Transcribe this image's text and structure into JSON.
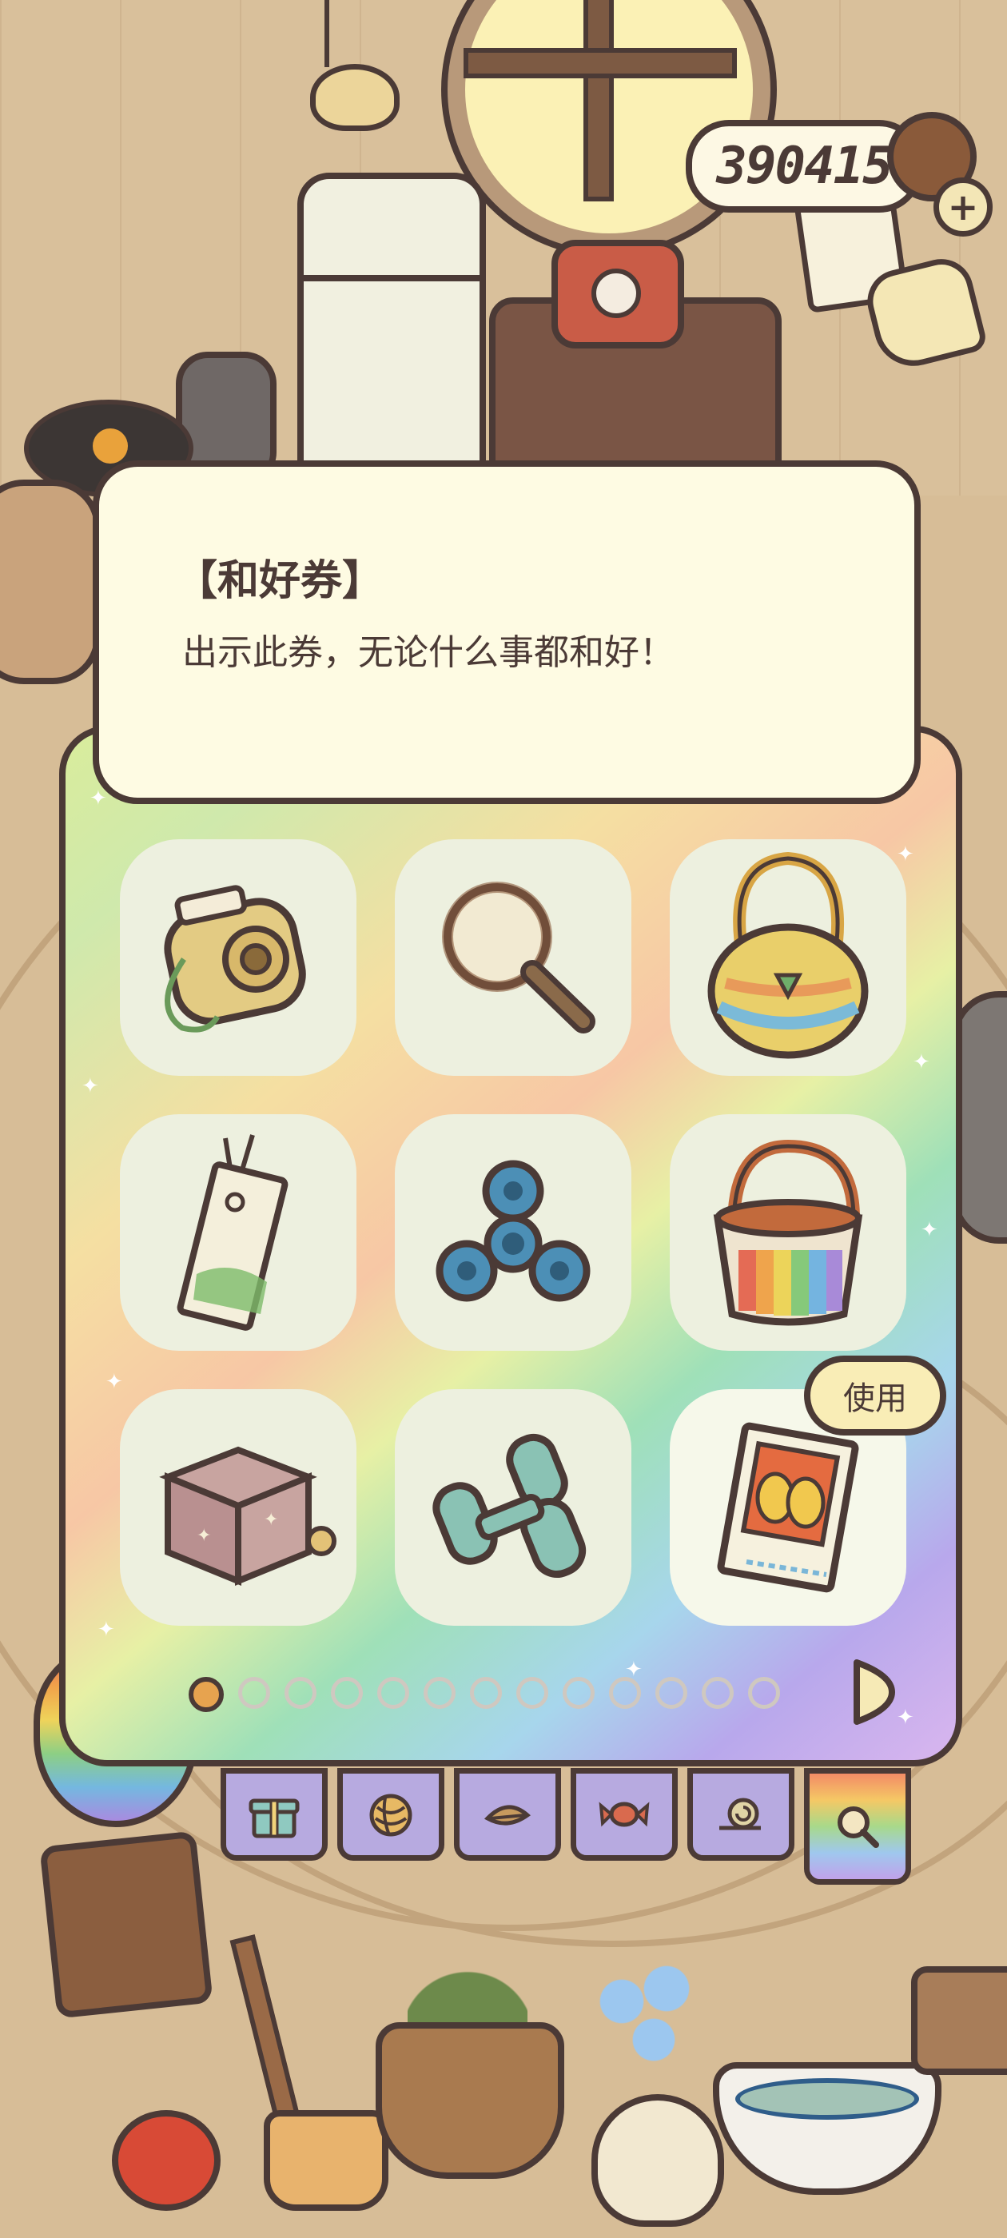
{
  "currency": {
    "amount": "390415",
    "add_icon": "plus-icon"
  },
  "item_detail": {
    "title": "【和好券】",
    "description": "出示此券，无论什么事都和好！"
  },
  "inventory": {
    "slots": [
      {
        "item": "instant-camera-icon"
      },
      {
        "item": "magnifying-glass-icon"
      },
      {
        "item": "knitted-bag-icon"
      },
      {
        "item": "bookmark-tag-icon"
      },
      {
        "item": "fidget-spinner-icon"
      },
      {
        "item": "rainbow-basket-icon"
      },
      {
        "item": "music-box-icon"
      },
      {
        "item": "dumbbells-icon"
      },
      {
        "item": "reconciliation-ticket-icon",
        "selected": true
      }
    ],
    "use_button_label": "使用",
    "page_count": 13,
    "current_page": 1
  },
  "category_tabs": [
    "gift-icon",
    "yarn-ball-icon",
    "leaf-icon",
    "candy-icon",
    "snail-icon",
    "magnifier-tab-icon"
  ],
  "colors": {
    "outline": "#4b3a36",
    "panel_card": "#fefbe3",
    "slot_bg": "#edf0df",
    "page_active": "#e7a34f"
  }
}
